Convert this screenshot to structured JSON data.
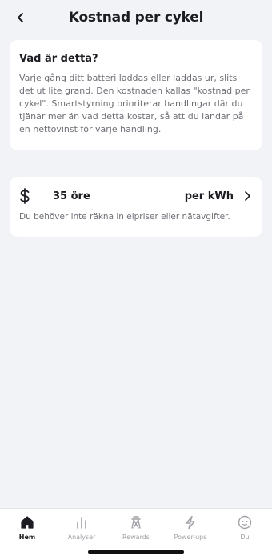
{
  "header": {
    "title": "Kostnad per cykel",
    "back_icon": "chevron-left-icon"
  },
  "info_card": {
    "title": "Vad är detta?",
    "body": "Varje gång ditt batteri laddas eller laddas ur, slits det ut lite grand. Den kostnaden kallas \"kostnad per cykel\". Smartstyrning prioriterar handlingar där du tjänar mer än vad detta kostar, så att du landar på en nettovinst för varje handling."
  },
  "cost_card": {
    "icon": "dollar-icon",
    "value": "35 öre",
    "unit": "per kWh",
    "description": "Du behöver inte räkna in elpriser eller nätavgifter."
  },
  "tabbar": {
    "tabs": [
      {
        "label": "Hem",
        "icon": "home-icon",
        "active": true
      },
      {
        "label": "Analyser",
        "icon": "bar-chart-icon",
        "active": false
      },
      {
        "label": "Rewards",
        "icon": "power-tower-icon",
        "active": false
      },
      {
        "label": "Power-ups",
        "icon": "lightning-icon",
        "active": false
      },
      {
        "label": "Du",
        "icon": "smiley-icon",
        "active": false
      }
    ]
  },
  "colors": {
    "background": "#f1f3f7",
    "card": "#ffffff",
    "text_primary": "#1c1c22",
    "text_secondary": "#6e6e76",
    "tab_inactive": "#a0a1a7"
  }
}
